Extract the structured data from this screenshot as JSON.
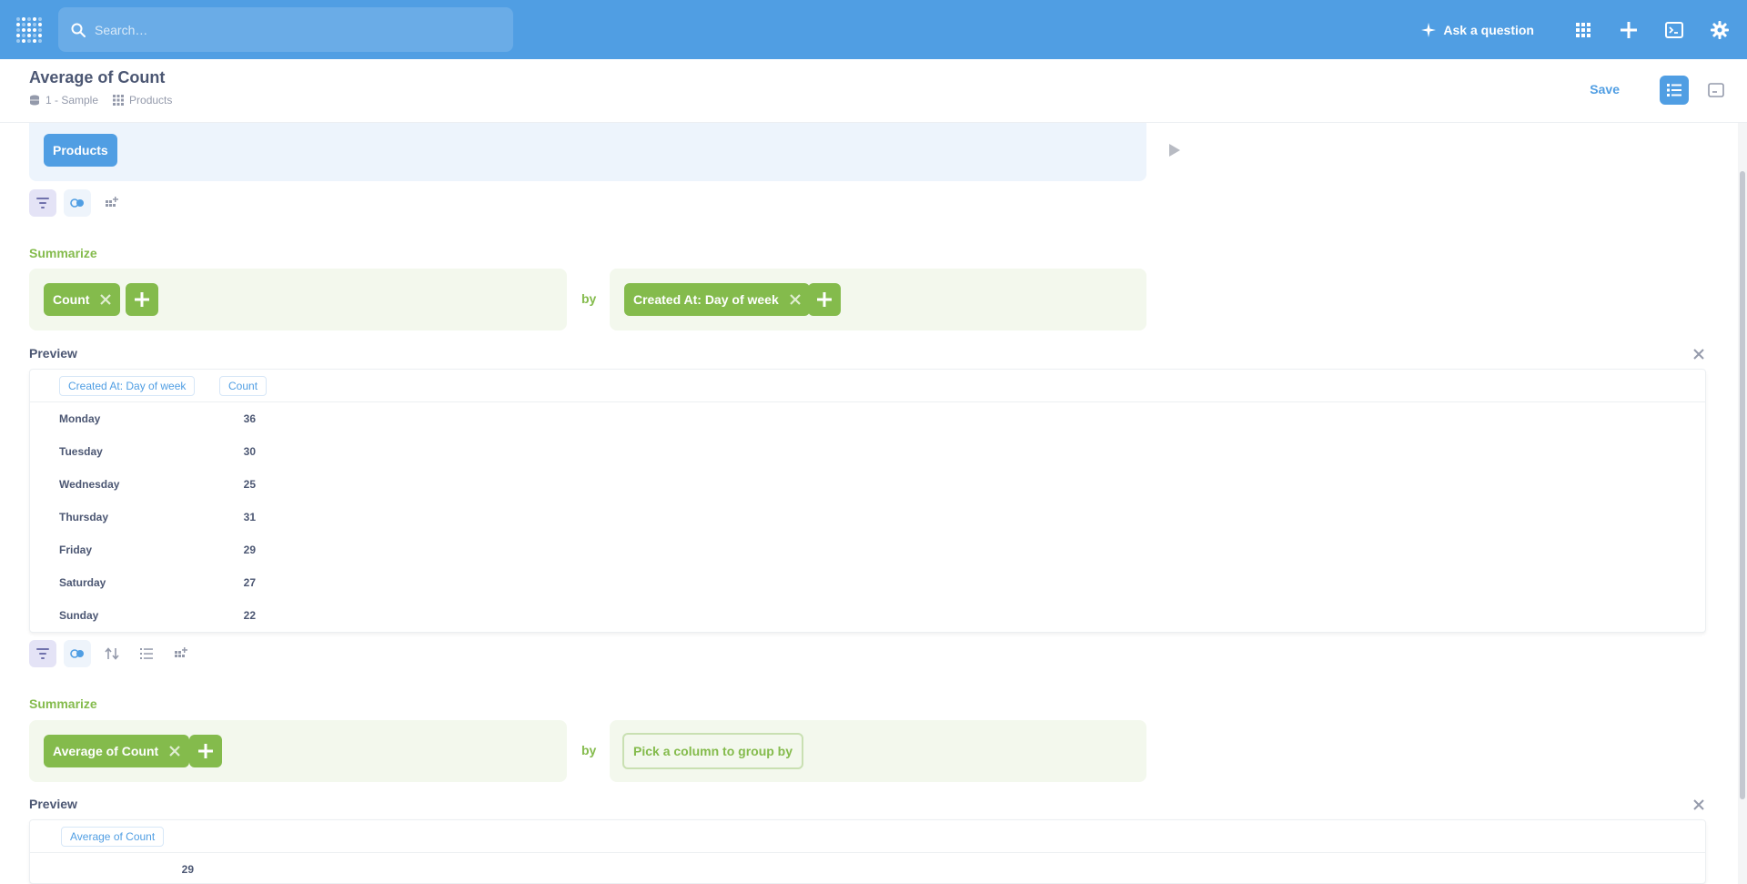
{
  "nav": {
    "search_placeholder": "Search…",
    "ask_label": "Ask a question"
  },
  "header": {
    "title": "Average of Count",
    "database": "1 - Sample",
    "table": "Products",
    "save_label": "Save"
  },
  "data_step": {
    "table": "Products"
  },
  "summarize1": {
    "label": "Summarize",
    "metric": "Count",
    "by": "by",
    "breakout": "Created At: Day of week"
  },
  "preview1": {
    "label": "Preview",
    "columns": [
      "Created At: Day of week",
      "Count"
    ],
    "rows": [
      [
        "Monday",
        "36"
      ],
      [
        "Tuesday",
        "30"
      ],
      [
        "Wednesday",
        "25"
      ],
      [
        "Thursday",
        "31"
      ],
      [
        "Friday",
        "29"
      ],
      [
        "Saturday",
        "27"
      ],
      [
        "Sunday",
        "22"
      ]
    ]
  },
  "summarize2": {
    "label": "Summarize",
    "metric": "Average of Count",
    "by": "by",
    "pick_label": "Pick a column to group by"
  },
  "preview2": {
    "label": "Preview",
    "columns": [
      "Average of Count"
    ],
    "rows": [
      [
        "29"
      ]
    ]
  },
  "colors": {
    "brand": "#509ee3",
    "summarize": "#84bb4c",
    "text": "#4c5773",
    "muted": "#949aab"
  }
}
